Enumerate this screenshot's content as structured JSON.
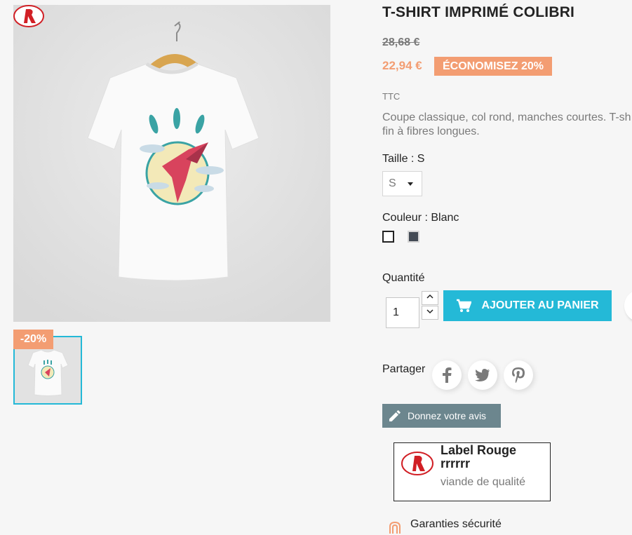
{
  "product": {
    "title": "T-SHIRT IMPRIMÉ COLIBRI",
    "regular_price": "28,68 €",
    "price": "22,94 €",
    "discount_badge": "ÉCONOMISEZ 20%",
    "tax_label": "TTC",
    "description_line1": "Coupe classique, col rond, manches courtes. T-sh",
    "description_line2": "fin à fibres longues.",
    "flag": "-20%"
  },
  "variants": {
    "size_label": "Taille : S",
    "size_value": "S",
    "color_label": "Couleur : Blanc",
    "colors": [
      {
        "name": "Blanc",
        "hex": "#ffffff",
        "selected": true
      },
      {
        "name": "Gris",
        "hex": "#434a54",
        "selected": false
      }
    ]
  },
  "cart": {
    "quantity_label": "Quantité",
    "quantity_value": "1",
    "add_to_cart_label": "AJOUTER AU PANIER"
  },
  "share": {
    "label": "Partager",
    "networks": [
      "facebook-icon",
      "twitter-icon",
      "pinterest-icon"
    ]
  },
  "review": {
    "button_label": "Donnez votre avis"
  },
  "reassurance": {
    "title": "Label Rouge rrrrrr",
    "subtitle": "viande de qualité",
    "logo_text": "label Rouge",
    "footer_item": "Garanties sécurité"
  },
  "colors": {
    "accent": "#24b9d7",
    "discount": "#f39d72",
    "review_button": "#6c868e",
    "text_muted": "#7a7a7a"
  }
}
